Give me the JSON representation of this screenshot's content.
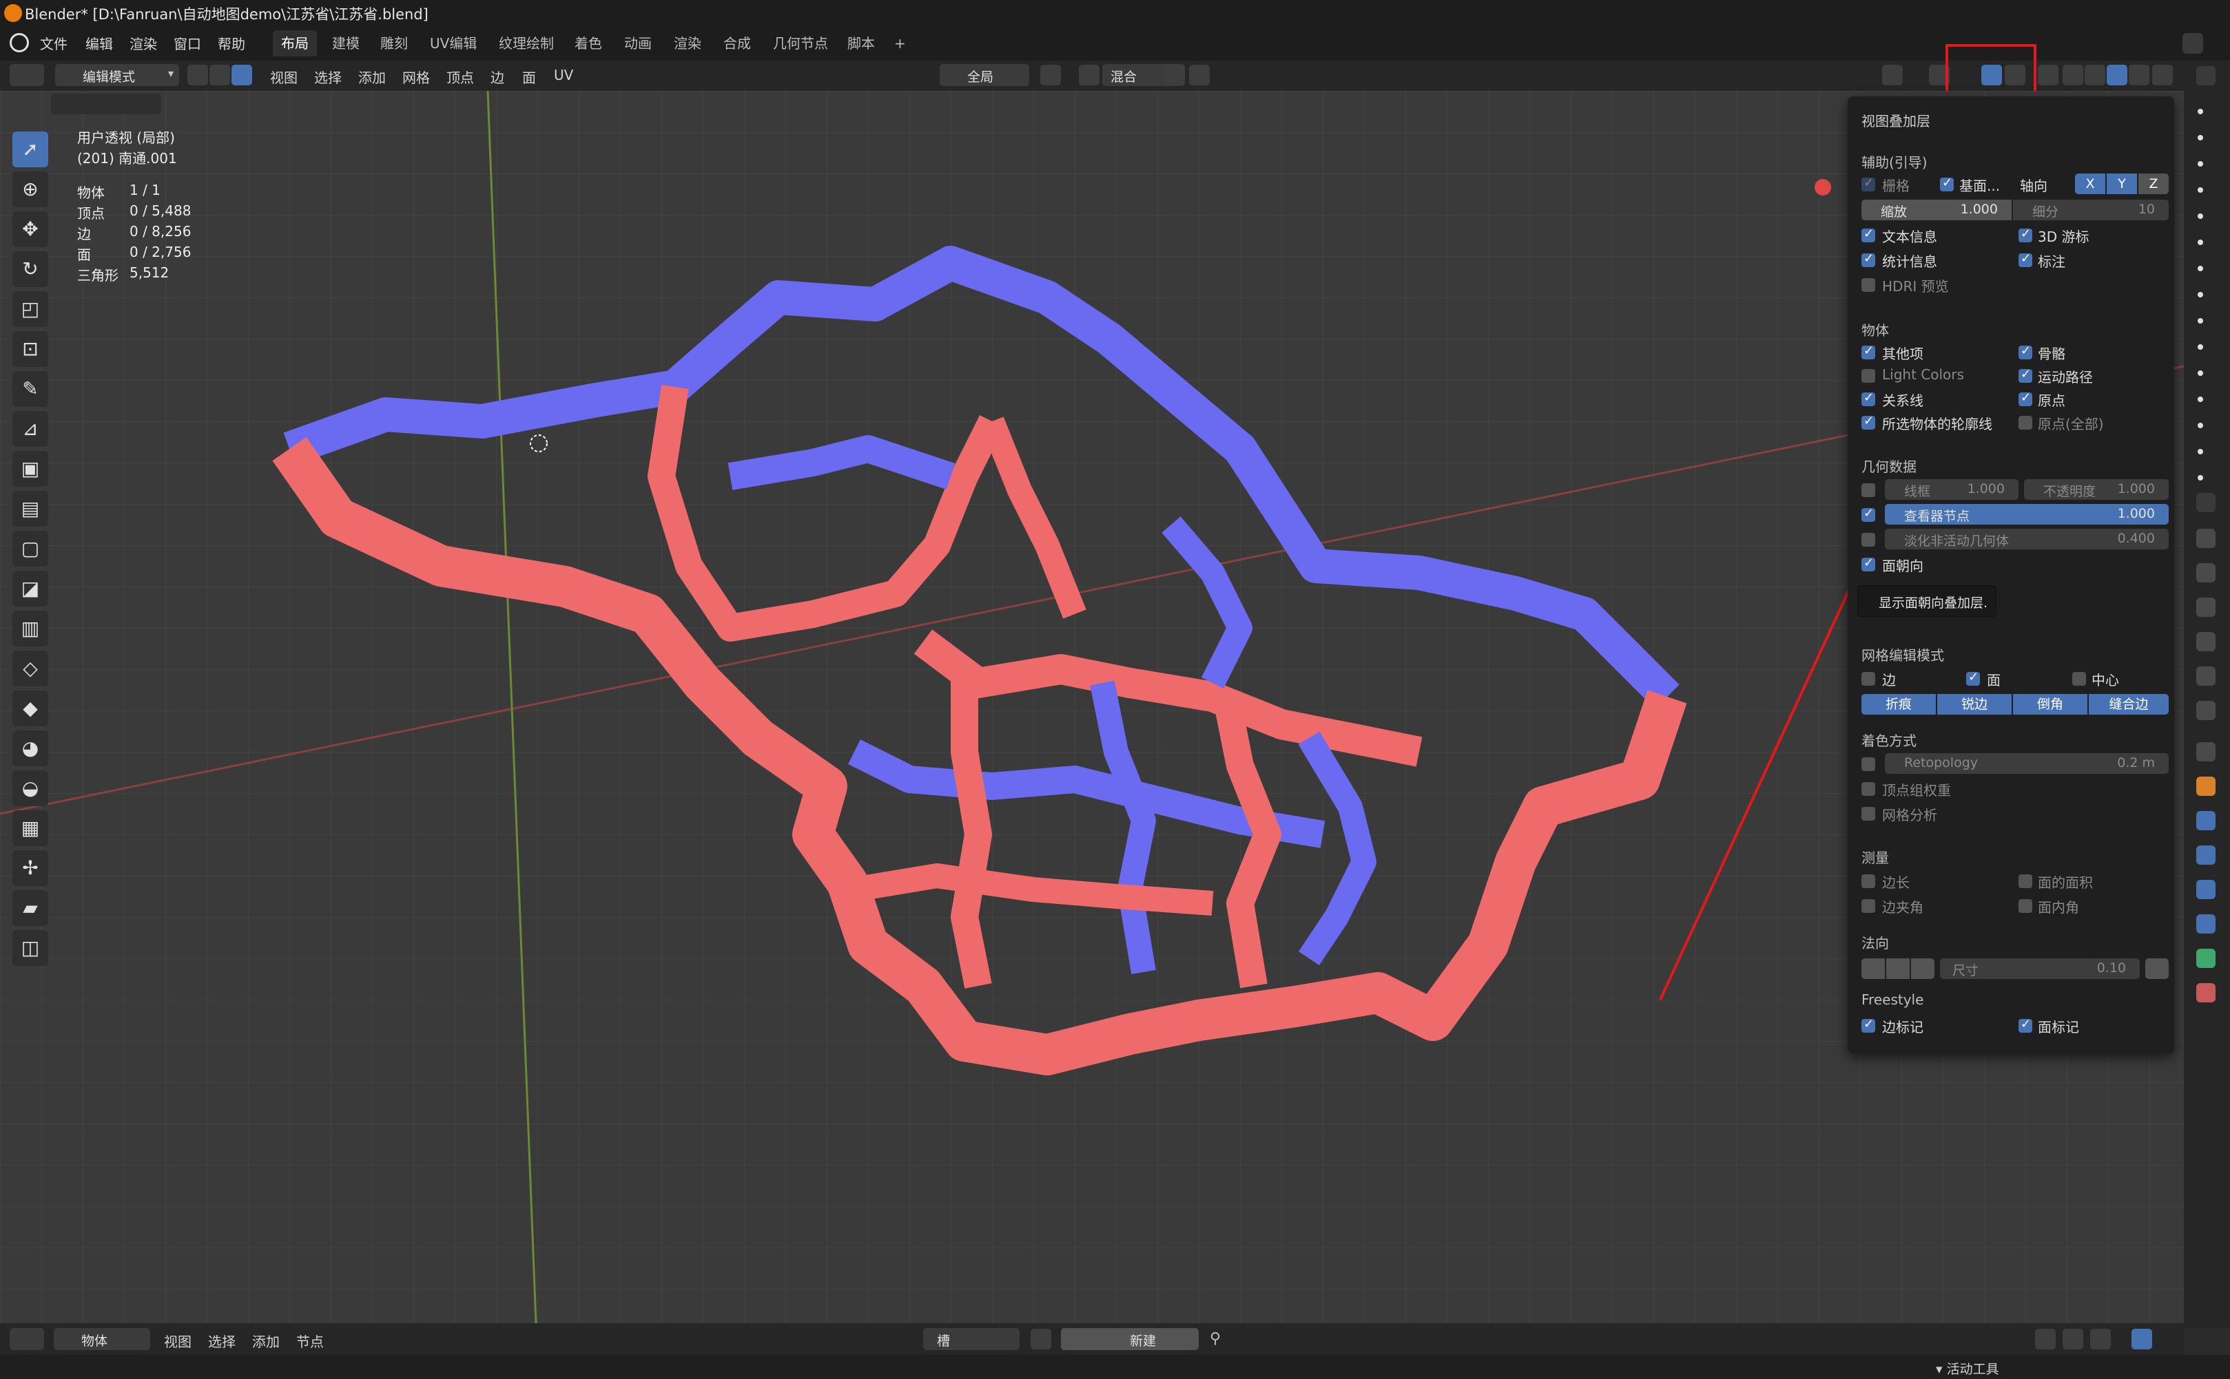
{
  "window": {
    "title": "Blender* [D:\\Fanruan\\自动地图demo\\江苏省\\江苏省.blend]"
  },
  "menus": [
    "文件",
    "编辑",
    "渲染",
    "窗口",
    "帮助"
  ],
  "workspaces": [
    "布局",
    "建模",
    "雕刻",
    "UV编辑",
    "纹理绘制",
    "着色",
    "动画",
    "渲染",
    "合成",
    "几何节点",
    "脚本",
    "+"
  ],
  "active_workspace": "布局",
  "header": {
    "mode": "编辑模式",
    "menus": [
      "视图",
      "选择",
      "添加",
      "网格",
      "顶点",
      "边",
      "面",
      "UV"
    ],
    "transform_orientation": "全局",
    "proportional": "混合"
  },
  "viewport_info": {
    "view_name": "用户透视 (局部)",
    "object_name": "(201) 南通.001",
    "stats": [
      {
        "label": "物体",
        "value": "1 / 1"
      },
      {
        "label": "顶点",
        "value": "0 / 5,488"
      },
      {
        "label": "边",
        "value": "0 / 8,256"
      },
      {
        "label": "面",
        "value": "0 / 2,756"
      },
      {
        "label": "三角形",
        "value": "5,512"
      }
    ]
  },
  "overlay": {
    "title": "视图叠加层",
    "guides": {
      "heading": "辅助(引导)",
      "grid": "栅格",
      "floor": "基面...",
      "axis": "轴向",
      "axes": [
        "X",
        "Y",
        "Z"
      ],
      "scale_label": "缩放",
      "scale_value": "1.000",
      "subdiv_label": "细分",
      "subdiv_value": "10",
      "text_info": "文本信息",
      "cursor_3d": "3D 游标",
      "stats": "统计信息",
      "annotations": "标注",
      "hdri": "HDRI 预览"
    },
    "objects": {
      "heading": "物体",
      "extras": "其他项",
      "bones": "骨骼",
      "light_colors": "Light Colors",
      "motion_paths": "运动路径",
      "relations": "关系线",
      "origins": "原点",
      "outline": "所选物体的轮廓线",
      "origins_all": "原点(全部)"
    },
    "geometry": {
      "heading": "几何数据",
      "wireframe_label": "线框",
      "wireframe_value": "1.000",
      "opacity_label": "不透明度",
      "opacity_value": "1.000",
      "viewer_label": "查看器节点",
      "viewer_value": "1.000",
      "fade_label": "淡化非活动几何体",
      "fade_value": "0.400",
      "face_orientation": "面朝向",
      "tooltip": "显示面朝向叠加层."
    },
    "mesh_edit": {
      "heading": "网格编辑模式",
      "edge": "边",
      "face": "面",
      "center": "中心",
      "buttons": [
        "折痕",
        "锐边",
        "倒角",
        "缝合边"
      ]
    },
    "shading": {
      "heading": "着色方式",
      "retopo_label": "Retopology",
      "retopo_value": "0.2 m",
      "vertex_group": "顶点组权重",
      "mesh_analysis": "网格分析"
    },
    "measurement": {
      "heading": "测量",
      "edge_length": "边长",
      "face_area": "面的面积",
      "edge_angle": "边夹角",
      "face_angle": "面内角"
    },
    "normals": {
      "heading": "法向",
      "size_label": "尺寸",
      "size_value": "0.10"
    },
    "freestyle": {
      "heading": "Freestyle",
      "edge_marks": "边标记",
      "face_marks": "面标记"
    }
  },
  "bottom_bar": {
    "mode": "物体",
    "menus": [
      "视图",
      "选择",
      "添加",
      "节点"
    ],
    "slot": "槽",
    "new_button": "新建"
  },
  "status_bar": {
    "panel_label": "活动工具"
  },
  "colors": {
    "accent": "#4772b3",
    "face_front": "#6a6bf0",
    "face_back": "#ef6b6b",
    "highlight": "#e01a1a"
  }
}
